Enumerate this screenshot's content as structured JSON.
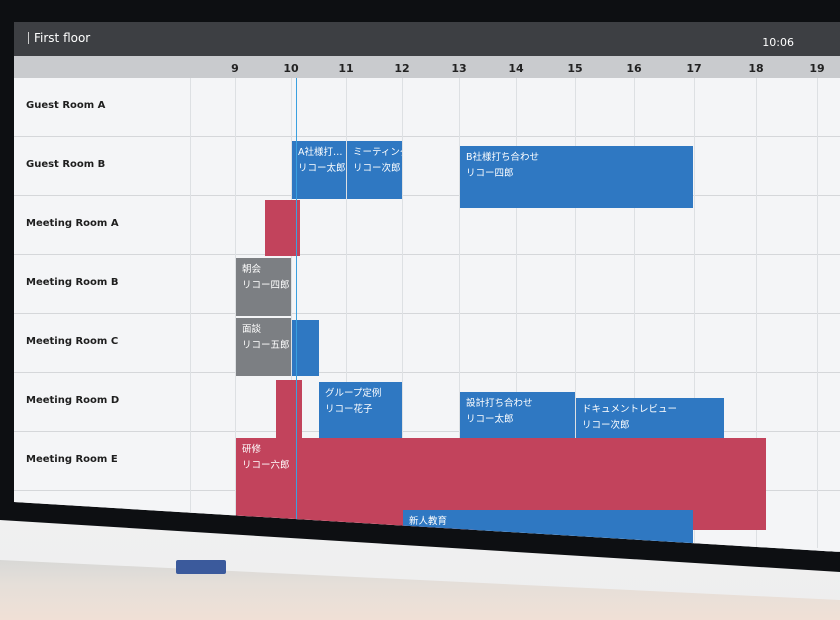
{
  "header": {
    "title": "First floor",
    "time": "10:06"
  },
  "hours": [
    "9",
    "10",
    "11",
    "12",
    "13",
    "14",
    "15",
    "16",
    "17",
    "18",
    "19"
  ],
  "rooms": [
    "Guest Room A",
    "Guest Room B",
    "Meeting Room A",
    "Meeting Room B",
    "Meeting Room C",
    "Meeting Room D",
    "Meeting Room E"
  ],
  "events": [
    {
      "title": "A社様打…",
      "person": "リコー太郎",
      "color": "blue"
    },
    {
      "title": "ミーティング",
      "person": "リコー次郎",
      "color": "blue"
    },
    {
      "title": "B社様打ち合わせ",
      "person": "リコー四郎",
      "color": "blue"
    },
    {
      "title": "",
      "person": "",
      "color": "red"
    },
    {
      "title": "朝会",
      "person": "リコー四郎",
      "color": "gray"
    },
    {
      "title": "面談",
      "person": "リコー五郎",
      "color": "gray"
    },
    {
      "title": "",
      "person": "",
      "color": "blue"
    },
    {
      "title": "",
      "person": "",
      "color": "red"
    },
    {
      "title": "グループ定例",
      "person": "リコー花子",
      "color": "blue"
    },
    {
      "title": "設計打ち合わせ",
      "person": "リコー太郎",
      "color": "blue"
    },
    {
      "title": "ドキュメントレビュー",
      "person": "リコー次郎",
      "color": "blue"
    },
    {
      "title": "研修",
      "person": "リコー六郎",
      "color": "red"
    },
    {
      "title": "新人教育",
      "person": "",
      "color": "blue"
    }
  ]
}
